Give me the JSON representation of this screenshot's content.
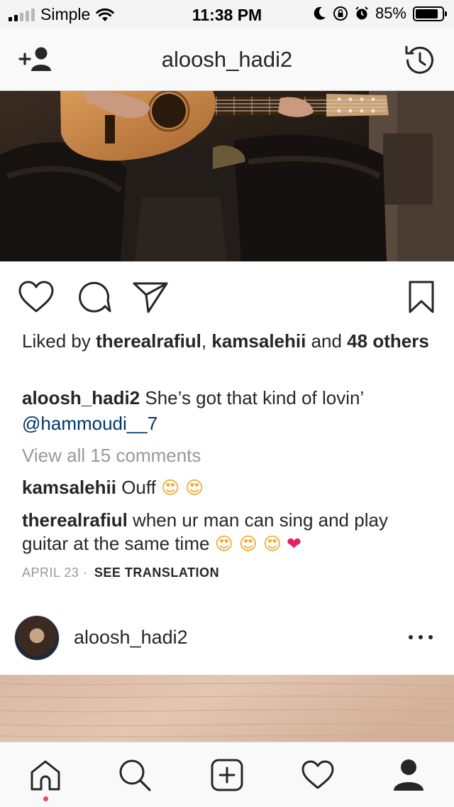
{
  "status_bar": {
    "carrier": "Simple",
    "time": "11:38 PM",
    "battery_percent": "85%",
    "battery_level": 0.85,
    "icons": [
      "signal-icon",
      "wifi-icon",
      "moon-icon",
      "rotation-lock-icon",
      "alarm-icon",
      "battery-icon"
    ]
  },
  "header": {
    "title": "aloosh_hadi2",
    "left_icon": "add-user-icon",
    "right_icon": "history-icon"
  },
  "post": {
    "image_description_icon": "photo",
    "actions": {
      "icons": [
        "heart-icon",
        "comment-icon",
        "share-icon",
        "bookmark-icon"
      ]
    },
    "likes": {
      "prefix": "Liked by ",
      "user1": "therealrafiul",
      "separator": ", ",
      "user2": "kamsalehii",
      "and": " and ",
      "others": "48 others"
    },
    "caption": {
      "username": "aloosh_hadi2",
      "text": " She’s got that kind of lovin’",
      "mention": "@hammoudi__7"
    },
    "view_all": "View all 15 comments",
    "comments": [
      {
        "username": "kamsalehii",
        "text": " Ouff ",
        "emoji": "😍 😍"
      },
      {
        "username": "therealrafiul",
        "text": " when ur man can sing and play guitar at the same time ",
        "emoji": "😍 😍 😍",
        "heart": "❤"
      }
    ],
    "date": "APRIL 23",
    "meta_separator": " · ",
    "see_translation": "SEE TRANSLATION"
  },
  "next_post": {
    "username": "aloosh_hadi2",
    "more_icon": "more-icon"
  },
  "tab_bar": {
    "tabs": [
      "home-icon",
      "search-icon",
      "new-post-icon",
      "activity-icon",
      "profile-icon"
    ],
    "active": "home-icon"
  },
  "colors": {
    "text": "#262626",
    "mention": "#003569",
    "muted": "#999999",
    "notification_dot": "#ed4956",
    "border": "#dbdbdb"
  }
}
